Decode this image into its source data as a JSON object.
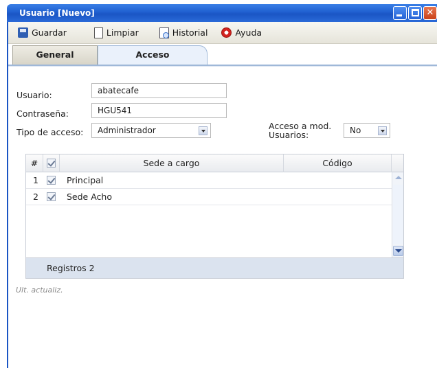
{
  "window": {
    "title": "Usuario [Nuevo]"
  },
  "toolbar": {
    "save_label": "Guardar",
    "clear_label": "Limpiar",
    "history_label": "Historial",
    "help_label": "Ayuda"
  },
  "tabs": {
    "general": "General",
    "acceso": "Acceso",
    "active": "Acceso"
  },
  "form": {
    "usuario_label": "Usuario:",
    "usuario_value": "abatecafe",
    "password_label": "Contraseña:",
    "password_value": "HGU541",
    "tipo_label": "Tipo de acceso:",
    "tipo_value": "Administrador",
    "acceso_mod_label_line1": "Acceso a mod.",
    "acceso_mod_label_line2": "Usuarios:",
    "acceso_mod_value": "No"
  },
  "grid": {
    "headers": {
      "num": "#",
      "sede": "Sede a cargo",
      "codigo": "Código"
    },
    "rows": [
      {
        "num": "1",
        "checked": true,
        "sede": "Principal",
        "codigo": ""
      },
      {
        "num": "2",
        "checked": true,
        "sede": "Sede Acho",
        "codigo": ""
      }
    ],
    "footer": "Registros 2"
  },
  "status": {
    "last_update": "Ult. actualiz."
  }
}
